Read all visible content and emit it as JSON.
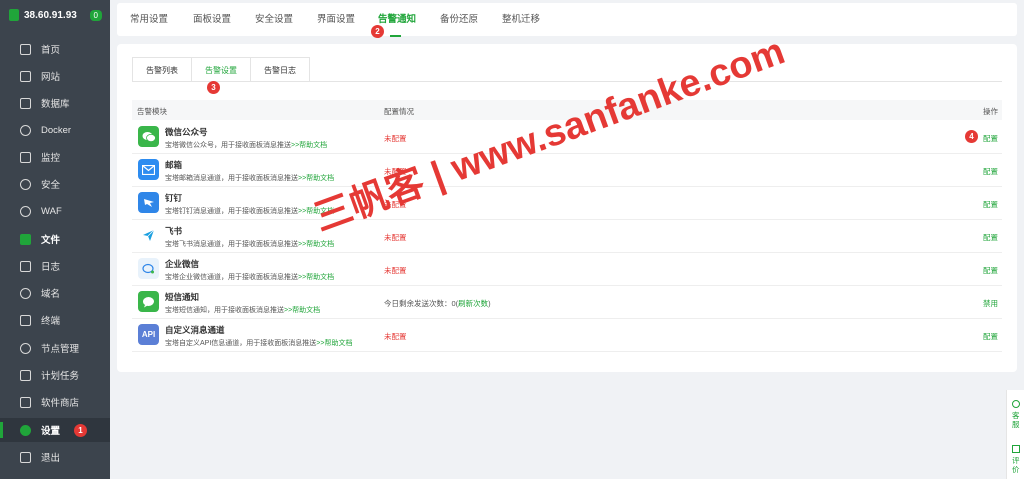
{
  "server": {
    "ip": "38.60.91.93",
    "badge": "0"
  },
  "sidebar": {
    "items": [
      {
        "label": "首页",
        "icon": "home-icon"
      },
      {
        "label": "网站",
        "icon": "website-icon"
      },
      {
        "label": "数据库",
        "icon": "database-icon"
      },
      {
        "label": "Docker",
        "icon": "docker-icon"
      },
      {
        "label": "监控",
        "icon": "monitor-icon"
      },
      {
        "label": "安全",
        "icon": "shield-icon"
      },
      {
        "label": "WAF",
        "icon": "waf-icon"
      },
      {
        "label": "文件",
        "icon": "folder-icon"
      },
      {
        "label": "日志",
        "icon": "log-icon"
      },
      {
        "label": "域名",
        "icon": "domain-icon"
      },
      {
        "label": "终端",
        "icon": "terminal-icon"
      },
      {
        "label": "节点管理",
        "icon": "node-icon"
      },
      {
        "label": "计划任务",
        "icon": "calendar-icon"
      },
      {
        "label": "软件商店",
        "icon": "store-icon"
      },
      {
        "label": "设置",
        "icon": "settings-icon"
      },
      {
        "label": "退出",
        "icon": "logout-icon"
      }
    ]
  },
  "tabs": [
    "常用设置",
    "面板设置",
    "安全设置",
    "界面设置",
    "告警通知",
    "备份还原",
    "整机迁移"
  ],
  "subtabs": [
    "告警列表",
    "告警设置",
    "告警日志"
  ],
  "table": {
    "headers": [
      "告警模块",
      "配置情况",
      "操作"
    ],
    "rows": [
      {
        "name": "微信公众号",
        "desc": "宝塔微信公众号，用于接收面板消息推送",
        "help": ">>帮助文档",
        "status": "未配置",
        "action": "配置",
        "icon_text": "",
        "color": "#3ab64a"
      },
      {
        "name": "邮箱",
        "desc": "宝塔邮箱消息通道，用于接收面板消息推送",
        "help": ">>帮助文档",
        "status": "未配置",
        "action": "配置",
        "icon_text": "",
        "color": "#2d8cf0"
      },
      {
        "name": "钉钉",
        "desc": "宝塔钉钉消息通道，用于接收面板消息推送",
        "help": ">>帮助文档",
        "status": "未配置",
        "action": "配置",
        "icon_text": "",
        "color": "#2f86e8"
      },
      {
        "name": "飞书",
        "desc": "宝塔飞书消息通道，用于接收面板消息推送",
        "help": ">>帮助文档",
        "status": "未配置",
        "action": "配置",
        "icon_text": "",
        "color": "#ffffff"
      },
      {
        "name": "企业微信",
        "desc": "宝塔企业微信通道，用于接收面板消息推送",
        "help": ">>帮助文档",
        "status": "未配置",
        "action": "配置",
        "icon_text": "",
        "color": "#e8f2fb"
      },
      {
        "name": "短信通知",
        "desc": "宝塔短信通知，用于接收面板消息推送",
        "help": ">>帮助文档",
        "status": "今日剩余发送次数：0(",
        "status_link": "刷新次数",
        "status_end": ")",
        "action": "禁用",
        "icon_text": "",
        "color": "#3ab64a"
      },
      {
        "name": "自定义消息通道",
        "desc": "宝塔自定义API信息通道，用于接收面板消息推送",
        "help": ">>帮助文档",
        "status": "未配置",
        "action": "配置",
        "icon_text": "API",
        "color": "#5b7fd6"
      }
    ]
  },
  "annotations": [
    "1",
    "2",
    "3",
    "4"
  ],
  "watermark": "三帆客 | www.sanfanke.com",
  "float": {
    "service": "客服",
    "review": "评价"
  },
  "colors": {
    "accent": "#20a53a",
    "danger": "#e53935",
    "sidebar": "#3c444d"
  }
}
